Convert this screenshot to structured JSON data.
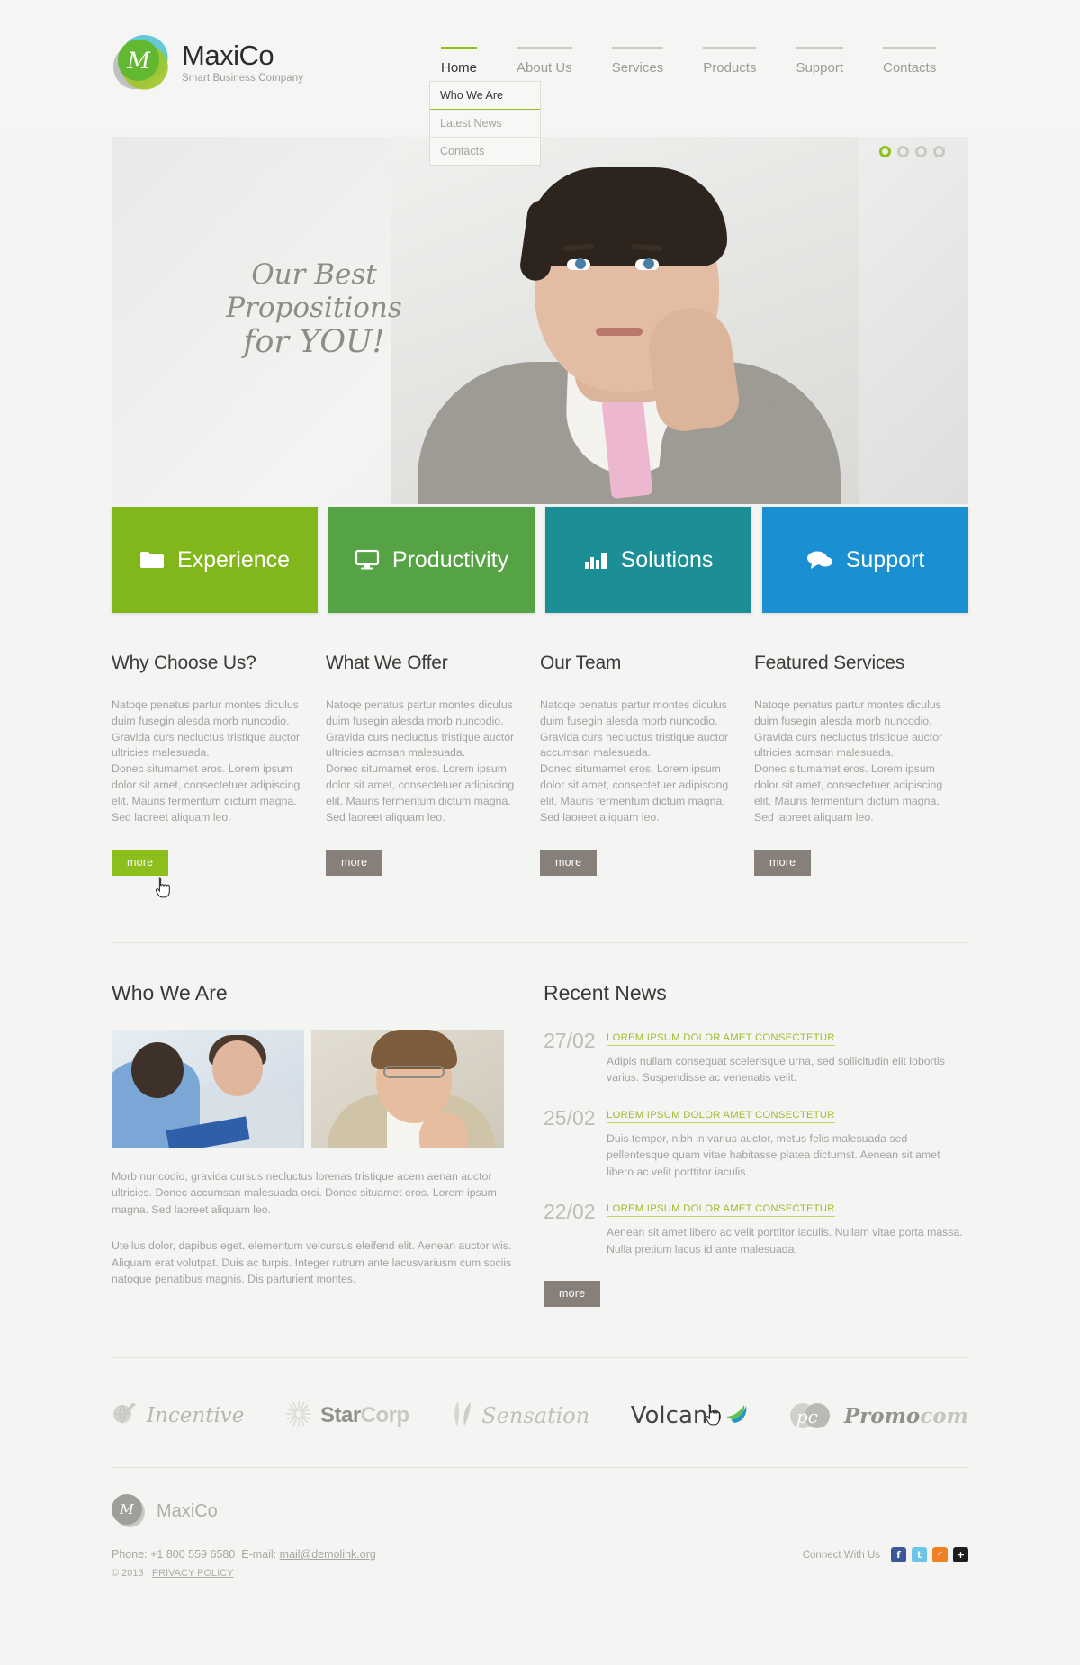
{
  "brand": {
    "title": "MaxiCo",
    "tagline": "Smart Business Company",
    "mark_letter": "M"
  },
  "nav": {
    "items": [
      {
        "label": "Home",
        "active": true
      },
      {
        "label": "About Us",
        "active": false
      },
      {
        "label": "Services",
        "active": false
      },
      {
        "label": "Products",
        "active": false
      },
      {
        "label": "Support",
        "active": false
      },
      {
        "label": "Contacts",
        "active": false
      }
    ],
    "dropdown": [
      {
        "label": "Who We Are",
        "highlighted": true
      },
      {
        "label": "Latest News",
        "highlighted": false
      },
      {
        "label": "Contacts",
        "highlighted": false
      }
    ]
  },
  "hero": {
    "caption_line1": "Our Best Propositions",
    "caption_line2": "for YOU!",
    "slide_count": 4,
    "active_slide": 1
  },
  "features": [
    {
      "label": "Experience",
      "icon": "folder-icon",
      "color": "#82b71b"
    },
    {
      "label": "Productivity",
      "icon": "monitor-icon",
      "color": "#55a345"
    },
    {
      "label": "Solutions",
      "icon": "barchart-icon",
      "color": "#1c8e96"
    },
    {
      "label": "Support",
      "icon": "chat-icon",
      "color": "#1a8fd1"
    }
  ],
  "columns": [
    {
      "title": "Why Choose Us?",
      "p1": "Natoqe penatus partur montes diculus duim fusegin alesda morb nuncodio. Gravida curs necluctus tristique auctor ultricies  malesuada.",
      "p2": "Donec situmamet eros. Lorem ipsum dolor sit amet, consectetuer adipiscing elit. Mauris fermentum dictum magna. Sed laoreet aliquam leo.",
      "button": "more",
      "button_hover": true
    },
    {
      "title": "What We Offer",
      "p1": "Natoqe penatus partur montes diculus duim fusegin alesda morb nuncodio. Gravida curs necluctus tristique auctor ultricies acmsan malesuada.",
      "p2": "Donec situmamet eros. Lorem ipsum dolor sit amet, consectetuer adipiscing elit. Mauris fermentum dictum magna. Sed laoreet aliquam leo.",
      "button": "more",
      "button_hover": false
    },
    {
      "title": "Our Team",
      "p1": "Natoqe penatus partur montes diculus duim fusegin alesda morb nuncodio. Gravida curs necluctus tristique auctor accumsan malesuada.",
      "p2": "Donec situmamet eros. Lorem ipsum dolor sit amet, consectetuer adipiscing elit. Mauris fermentum dictum magna. Sed laoreet aliquam leo.",
      "button": "more",
      "button_hover": false
    },
    {
      "title": "Featured Services",
      "p1": "Natoqe penatus partur montes diculus duim fusegin alesda morb nuncodio. Gravida curs necluctus tristique auctor ultricies acmsan malesuada.",
      "p2": "Donec situmamet eros. Lorem ipsum dolor sit amet, consectetuer adipiscing elit. Mauris fermentum dictum magna. Sed laoreet aliquam leo.",
      "button": "more",
      "button_hover": false
    }
  ],
  "who_we_are": {
    "title": "Who We Are",
    "p1": "Morb nuncodio, gravida cursus necluctus lorenas tristique acem aenan auctor ultricies. Donec accumsan malesuada orci. Donec situamet eros. Lorem ipsum magna. Sed laoreet aliquam leo.",
    "p2": "Utellus dolor, dapibus eget, elementum velcursus eleifend elit. Aenean auctor wis. Aliquam erat volutpat. Duis ac turpis. Integer rutrum ante lacusvariusm cum sociis natoque penatibus magnis. Dis parturient  montes."
  },
  "news": {
    "title": "Recent News",
    "items": [
      {
        "date": "27/02",
        "headline": "LOREM IPSUM DOLOR AMET CONSECTETUR",
        "text": "Adipis nullam consequat scelerisque urna, sed sollicitudin elit lobortis varius. Suspendisse ac venenatis velit."
      },
      {
        "date": "25/02",
        "headline": "LOREM IPSUM DOLOR AMET CONSECTETUR",
        "text": "Duis tempor, nibh in varius auctor, metus felis malesuada sed pellentesque quam vitae habitasse platea dictumst. Aenean sit amet libero ac velit porttitor iaculis."
      },
      {
        "date": "22/02",
        "headline": "LOREM IPSUM DOLOR AMET CONSECTETUR",
        "text": "Aenean sit amet libero ac velit porttitor iaculis. Nullam vitae porta massa. Nulla pretium lacus id ante malesuada."
      }
    ],
    "button": "more"
  },
  "partners": [
    {
      "name": "Incentive",
      "icon": "globe-check-icon"
    },
    {
      "name_part1": "Star",
      "name_part2": "Corp",
      "icon": "sunburst-icon"
    },
    {
      "name": "Sensation",
      "icon": "leaf-icon"
    },
    {
      "name": "Volcano",
      "icon": "swoosh-icon",
      "hovered": true
    },
    {
      "name_part1": "Promo",
      "name_part2": "com",
      "badge": "pc",
      "icon": "circles-icon"
    }
  ],
  "footer": {
    "brand": "MaxiCo",
    "mark_letter": "M",
    "phone_label": "Phone:",
    "phone": "+1 800 559 6580",
    "email_label": "E-mail:",
    "email": "mail@demolink.org",
    "copyright": "© 2013 :",
    "privacy": "PRIVACY POLICY",
    "connect_label": "Connect With Us",
    "social": [
      {
        "name": "facebook-icon",
        "glyph": "f"
      },
      {
        "name": "twitter-icon",
        "glyph": "t"
      },
      {
        "name": "rss-icon",
        "glyph": "◜"
      },
      {
        "name": "addthis-icon",
        "glyph": "+"
      }
    ]
  }
}
